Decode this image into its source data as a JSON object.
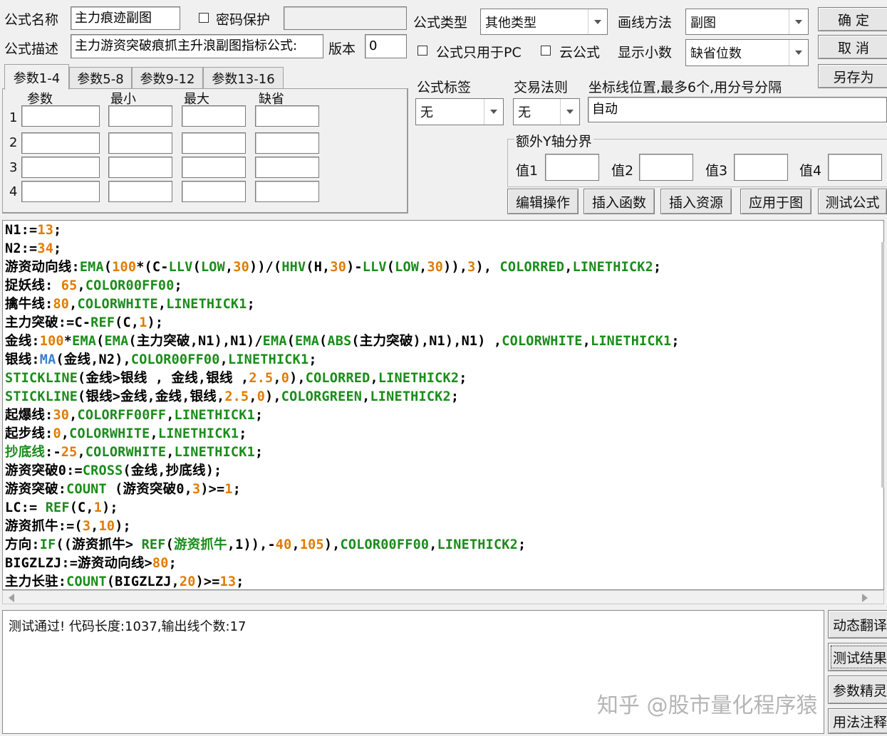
{
  "form": {
    "name_label": "公式名称",
    "name_value": "主力痕迹副图",
    "password_label": "密码保护",
    "desc_label": "公式描述",
    "desc_value": "主力游资突破痕抓主升浪副图指标公式:",
    "version_label": "版本",
    "version_value": "0",
    "type_label": "公式类型",
    "type_value": "其他类型",
    "draw_label": "画线方法",
    "draw_value": "副图",
    "pc_only_label": "公式只用于PC",
    "cloud_label": "云公式",
    "decimals_label": "显示小数",
    "decimals_value": "缺省位数",
    "tag_label": "公式标签",
    "tag_value": "无",
    "trade_label": "交易法则",
    "trade_value": "无",
    "axis_label": "坐标线位置,最多6个,用分号分隔",
    "axis_value": "自动",
    "y_group_label": "额外Y轴分界",
    "y_labels": [
      "值1",
      "值2",
      "值3",
      "值4"
    ]
  },
  "buttons": {
    "ok": "确  定",
    "cancel": "取  消",
    "save_as": "另存为",
    "edit_ops": "编辑操作",
    "insert_func": "插入函数",
    "insert_res": "插入资源",
    "apply_chart": "应用于图",
    "test_formula": "测试公式"
  },
  "tabs": [
    "参数1-4",
    "参数5-8",
    "参数9-12",
    "参数13-16"
  ],
  "params": {
    "headers": [
      "参数",
      "最小",
      "最大",
      "缺省"
    ],
    "rows": [
      "1",
      "2",
      "3",
      "4"
    ]
  },
  "colors": {
    "default": "#000000",
    "func": "#1a8c1a",
    "num": "#e07b00",
    "blue": "#3a7fd0"
  },
  "code_lines": [
    [
      [
        "N1:=",
        "default"
      ],
      [
        "13",
        "num"
      ],
      [
        ";",
        "default"
      ]
    ],
    [
      [
        "N2:=",
        "default"
      ],
      [
        "34",
        "num"
      ],
      [
        ";",
        "default"
      ]
    ],
    [
      [
        "游资动向线:",
        "default"
      ],
      [
        "EMA",
        "func"
      ],
      [
        "(",
        "default"
      ],
      [
        "100",
        "num"
      ],
      [
        "*(C-",
        "default"
      ],
      [
        "LLV",
        "func"
      ],
      [
        "(",
        "default"
      ],
      [
        "LOW",
        "func"
      ],
      [
        ",",
        "default"
      ],
      [
        "30",
        "num"
      ],
      [
        "))/(",
        "default"
      ],
      [
        "HHV",
        "func"
      ],
      [
        "(H,",
        "default"
      ],
      [
        "30",
        "num"
      ],
      [
        ")-",
        "default"
      ],
      [
        "LLV",
        "func"
      ],
      [
        "(",
        "default"
      ],
      [
        "LOW",
        "func"
      ],
      [
        ",",
        "default"
      ],
      [
        "30",
        "num"
      ],
      [
        ")),",
        "default"
      ],
      [
        "3",
        "num"
      ],
      [
        "), ",
        "default"
      ],
      [
        "COLORRED",
        "func"
      ],
      [
        ",",
        "default"
      ],
      [
        "LINETHICK2",
        "func"
      ],
      [
        ";",
        "default"
      ]
    ],
    [
      [
        "捉妖线: ",
        "default"
      ],
      [
        "65",
        "num"
      ],
      [
        ",",
        "default"
      ],
      [
        "COLOR00FF00",
        "func"
      ],
      [
        ";",
        "default"
      ]
    ],
    [
      [
        "擒牛线:",
        "default"
      ],
      [
        "80",
        "num"
      ],
      [
        ",",
        "default"
      ],
      [
        "COLORWHITE",
        "func"
      ],
      [
        ",",
        "default"
      ],
      [
        "LINETHICK1",
        "func"
      ],
      [
        ";",
        "default"
      ]
    ],
    [
      [
        "主力突破:=C-",
        "default"
      ],
      [
        "REF",
        "func"
      ],
      [
        "(C,",
        "default"
      ],
      [
        "1",
        "num"
      ],
      [
        ");",
        "default"
      ]
    ],
    [
      [
        "金线:",
        "default"
      ],
      [
        "100",
        "num"
      ],
      [
        "*",
        "default"
      ],
      [
        "EMA",
        "func"
      ],
      [
        "(",
        "default"
      ],
      [
        "EMA",
        "func"
      ],
      [
        "(主力突破,N1),N1)/",
        "default"
      ],
      [
        "EMA",
        "func"
      ],
      [
        "(",
        "default"
      ],
      [
        "EMA",
        "func"
      ],
      [
        "(",
        "default"
      ],
      [
        "ABS",
        "func"
      ],
      [
        "(主力突破),N1),N1) ,",
        "default"
      ],
      [
        "COLORWHITE",
        "func"
      ],
      [
        ",",
        "default"
      ],
      [
        "LINETHICK1",
        "func"
      ],
      [
        ";",
        "default"
      ]
    ],
    [
      [
        "银线:",
        "default"
      ],
      [
        "MA",
        "blue"
      ],
      [
        "(金线,N2),",
        "default"
      ],
      [
        "COLOR00FF00",
        "func"
      ],
      [
        ",",
        "default"
      ],
      [
        "LINETHICK1",
        "func"
      ],
      [
        ";",
        "default"
      ]
    ],
    [
      [
        "STICKLINE",
        "func"
      ],
      [
        "(金线>银线 , 金线,银线 ,",
        "default"
      ],
      [
        "2.5",
        "num"
      ],
      [
        ",",
        "default"
      ],
      [
        "0",
        "num"
      ],
      [
        "),",
        "default"
      ],
      [
        "COLORRED",
        "func"
      ],
      [
        ",",
        "default"
      ],
      [
        "LINETHICK2",
        "func"
      ],
      [
        ";",
        "default"
      ]
    ],
    [
      [
        "STICKLINE",
        "func"
      ],
      [
        "(银线>金线,金线,银线,",
        "default"
      ],
      [
        "2.5",
        "num"
      ],
      [
        ",",
        "default"
      ],
      [
        "0",
        "num"
      ],
      [
        "),",
        "default"
      ],
      [
        "COLORGREEN",
        "func"
      ],
      [
        ",",
        "default"
      ],
      [
        "LINETHICK2",
        "func"
      ],
      [
        ";",
        "default"
      ]
    ],
    [
      [
        "起爆线:",
        "default"
      ],
      [
        "30",
        "num"
      ],
      [
        ",",
        "default"
      ],
      [
        "COLORFF00FF",
        "func"
      ],
      [
        ",",
        "default"
      ],
      [
        "LINETHICK1",
        "func"
      ],
      [
        ";",
        "default"
      ]
    ],
    [
      [
        "起步线:",
        "default"
      ],
      [
        "0",
        "num"
      ],
      [
        ",",
        "default"
      ],
      [
        "COLORWHITE",
        "func"
      ],
      [
        ",",
        "default"
      ],
      [
        "LINETHICK1",
        "func"
      ],
      [
        ";",
        "default"
      ]
    ],
    [
      [
        "抄底线",
        "func"
      ],
      [
        ":-",
        "default"
      ],
      [
        "25",
        "num"
      ],
      [
        ",",
        "default"
      ],
      [
        "COLORWHITE",
        "func"
      ],
      [
        ",",
        "default"
      ],
      [
        "LINETHICK1",
        "func"
      ],
      [
        ";",
        "default"
      ]
    ],
    [
      [
        "游资突破0:=",
        "default"
      ],
      [
        "CROSS",
        "func"
      ],
      [
        "(金线,抄底线);",
        "default"
      ]
    ],
    [
      [
        "游资突破:",
        "default"
      ],
      [
        "COUNT",
        "func"
      ],
      [
        " (游资突破0,",
        "default"
      ],
      [
        "3",
        "num"
      ],
      [
        ")>=",
        "default"
      ],
      [
        "1",
        "num"
      ],
      [
        ";",
        "default"
      ]
    ],
    [
      [
        "LC:= ",
        "default"
      ],
      [
        "REF",
        "func"
      ],
      [
        "(C,",
        "default"
      ],
      [
        "1",
        "num"
      ],
      [
        ");",
        "default"
      ]
    ],
    [
      [
        "游资抓牛:=(",
        "default"
      ],
      [
        "3",
        "num"
      ],
      [
        ",",
        "default"
      ],
      [
        "10",
        "num"
      ],
      [
        ");",
        "default"
      ]
    ],
    [
      [
        "方向:",
        "default"
      ],
      [
        "IF",
        "func"
      ],
      [
        "((游资抓牛> ",
        "default"
      ],
      [
        "REF",
        "func"
      ],
      [
        "(",
        "default"
      ],
      [
        "游资抓牛",
        "func"
      ],
      [
        ",1)),-",
        "default"
      ],
      [
        "40",
        "num"
      ],
      [
        ",",
        "default"
      ],
      [
        "105",
        "num"
      ],
      [
        "),",
        "default"
      ],
      [
        "COLOR00FF00",
        "func"
      ],
      [
        ",",
        "default"
      ],
      [
        "LINETHICK2",
        "func"
      ],
      [
        ";",
        "default"
      ]
    ],
    [
      [
        "BIGZLZJ:=游资动向线>",
        "default"
      ],
      [
        "80",
        "num"
      ],
      [
        ";",
        "default"
      ]
    ],
    [
      [
        "主力长驻:",
        "default"
      ],
      [
        "COUNT",
        "func"
      ],
      [
        "(BIGZLZJ,",
        "default"
      ],
      [
        "20",
        "num"
      ],
      [
        ")>=",
        "default"
      ],
      [
        "13",
        "num"
      ],
      [
        ";",
        "default"
      ]
    ]
  ],
  "output_text": "测试通过! 代码长度:1037,输出线个数:17",
  "side_buttons": [
    "动态翻译",
    "测试结果",
    "参数精灵",
    "用法注释"
  ],
  "watermark": "知乎 @股市量化程序猿"
}
